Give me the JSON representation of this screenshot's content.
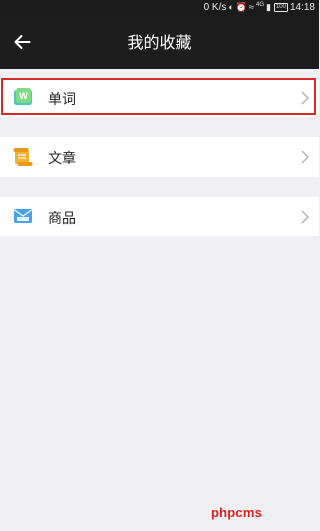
{
  "status_bar": {
    "speed": "0 K/s",
    "network": "4G",
    "battery": "100",
    "time": "14:18"
  },
  "header": {
    "title": "我的收藏"
  },
  "favorites": [
    {
      "label": "单词",
      "icon": "word-book-icon"
    },
    {
      "label": "文章",
      "icon": "article-scroll-icon"
    },
    {
      "label": "商品",
      "icon": "goods-envelope-icon"
    }
  ],
  "watermark": "phpcms",
  "colors": {
    "header_bg": "#1d1d1d",
    "page_bg": "#efeff4",
    "highlight_border": "#d52a2a"
  }
}
